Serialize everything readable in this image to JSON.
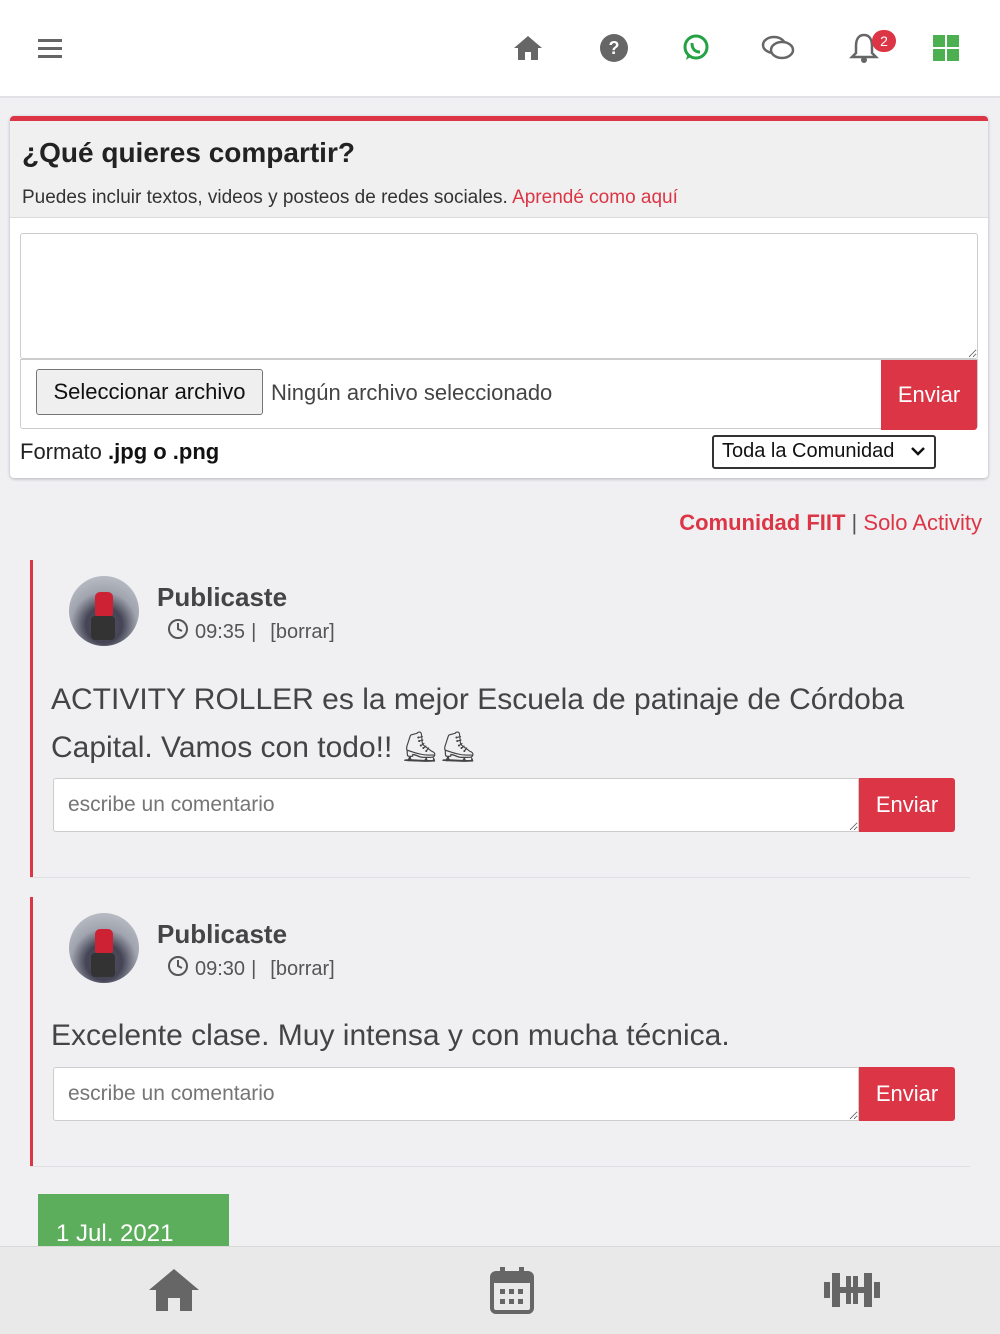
{
  "header": {
    "menu_icon": "hamburger-icon",
    "icons": [
      "home-icon",
      "help-icon",
      "whatsapp-icon",
      "chat-icon",
      "bell-icon",
      "apps-icon"
    ],
    "notification_count": "2"
  },
  "share": {
    "title": "¿Qué quieres compartir?",
    "subtitle": "Puedes incluir textos, videos y posteos de redes sociales.",
    "learn_link": "Aprendé como aquí",
    "file_button": "Seleccionar archivo",
    "file_status": "Ningún archivo seleccionado",
    "send": "Enviar",
    "format_prefix": "Formato",
    "format_value": ".jpg o .png",
    "scope_selected": "Toda la Comunidad"
  },
  "filter": {
    "community": "Comunidad FIIT",
    "separator": "|",
    "solo": "Solo Activity"
  },
  "posts": [
    {
      "author": "Publicaste",
      "time": "09:35",
      "separator": "|",
      "delete": "[borrar]",
      "body": "ACTIVITY ROLLER es la mejor Escuela de patinaje de Córdoba Capital. Vamos con todo!! ⛸⛸",
      "comment_placeholder": "escribe un comentario",
      "send": "Enviar"
    },
    {
      "author": "Publicaste",
      "time": "09:30",
      "separator": "|",
      "delete": "[borrar]",
      "body": "Excelente clase. Muy intensa y con mucha técnica.",
      "comment_placeholder": "escribe un comentario",
      "send": "Enviar"
    }
  ],
  "date_tag": "1 Jul. 2021",
  "bottom_nav": [
    "home-icon",
    "calendar-icon",
    "dumbbell-icon"
  ],
  "colors": {
    "accent": "#dc3545",
    "whatsapp": "#25a244",
    "apps": "#4caf50",
    "date_tag": "#5cae5c"
  }
}
